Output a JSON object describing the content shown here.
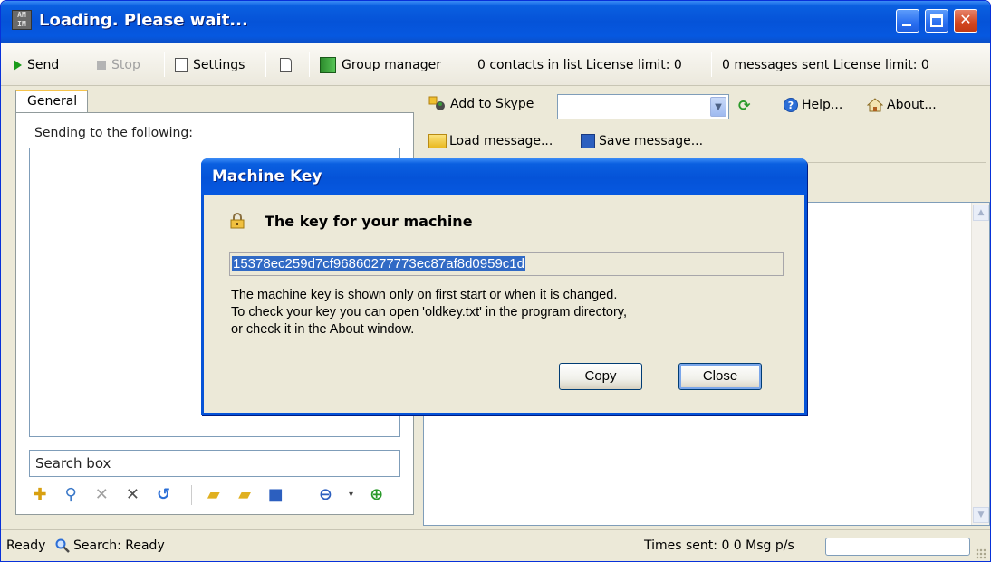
{
  "window": {
    "title": "Loading. Please wait...",
    "app_icon_text": "AM IM"
  },
  "toolbar": {
    "send_label": "Send",
    "stop_label": "Stop",
    "settings_label": "Settings",
    "group_manager_label": "Group manager",
    "contacts_status": "0 contacts in list  License limit: 0",
    "messages_status": "0 messages sent  License limit: 0"
  },
  "left_panel": {
    "tab_label": "General",
    "sending_label": "Sending to the following:",
    "search_placeholder": "Search box"
  },
  "right_panel": {
    "add_to_skype_label": "Add to Skype",
    "skype_combo_value": "",
    "help_label": "Help...",
    "about_label": "About...",
    "load_message_label": "Load message...",
    "save_message_label": "Save message..."
  },
  "statusbar": {
    "ready": "Ready",
    "search_status": "Search: Ready",
    "times_sent": "Times sent: 0  0 Msg p/s"
  },
  "dialog": {
    "title": "Machine Key",
    "heading": "The key for your machine",
    "machine_key": "15378ec259d7cf96860277773ec87af8d0959c1d",
    "desc_lines": [
      "The machine key is shown only on first start or when it is changed.",
      "To check your key you can open 'oldkey.txt' in the program directory,",
      "or check it in the About window."
    ],
    "copy_label": "Copy",
    "close_label": "Close"
  },
  "colors": {
    "titlebar_blue": "#0553d8",
    "selection_blue": "#316ac5",
    "xp_face": "#ece9d8"
  }
}
